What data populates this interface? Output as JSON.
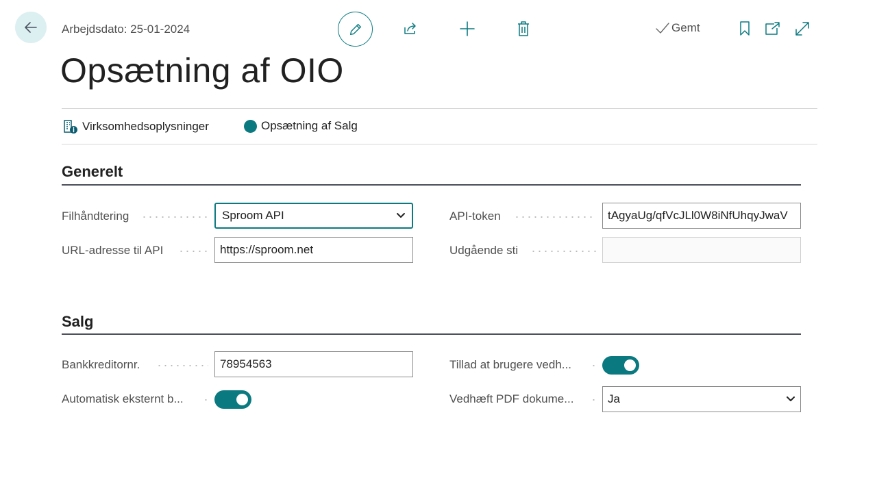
{
  "header": {
    "workdate": "Arbejdsdato: 25-01-2024",
    "saved_label": "Gemt"
  },
  "page": {
    "title": "Opsætning af OIO"
  },
  "actions": {
    "company_info": "Virksomhedsoplysninger",
    "sales_setup": "Opsætning af Salg"
  },
  "general": {
    "title": "Generelt",
    "file_handling_label": "Filhåndtering",
    "file_handling_value": "Sproom API",
    "api_url_label": "URL-adresse til API",
    "api_url_value": "https://sproom.net",
    "api_token_label": "API-token",
    "api_token_value": "tAgyaUg/qfVcJLl0W8iNfUhqyJwaV",
    "outgoing_path_label": "Udgående sti",
    "outgoing_path_value": ""
  },
  "sales": {
    "title": "Salg",
    "bank_creditor_label": "Bankkreditornr.",
    "bank_creditor_value": "78954563",
    "auto_external_label": "Automatisk eksternt b...",
    "auto_external_on": true,
    "allow_users_label": "Tillad at brugere vedh...",
    "allow_users_on": true,
    "attach_pdf_label": "Vedhæft PDF dokume...",
    "attach_pdf_value": "Ja"
  },
  "colors": {
    "accent": "#0a7a80",
    "back_button_bg": "#dceff1"
  }
}
